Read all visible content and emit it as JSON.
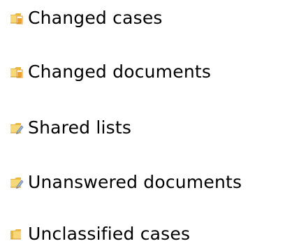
{
  "folders": [
    {
      "label": "Changed cases",
      "icon": "folder-with-document-icon"
    },
    {
      "label": "Changed documents",
      "icon": "folder-with-document-icon"
    },
    {
      "label": "Shared lists",
      "icon": "folder-with-pen-icon"
    },
    {
      "label": "Unanswered documents",
      "icon": "folder-with-pen-icon"
    },
    {
      "label": "Unclassified cases",
      "icon": "folder-icon"
    }
  ],
  "colors": {
    "folder_light": "#F7D879",
    "folder_dark": "#D9A72C",
    "document_orange": "#F0A030",
    "pen_blue": "#9CB6D8",
    "text": "#000000"
  }
}
